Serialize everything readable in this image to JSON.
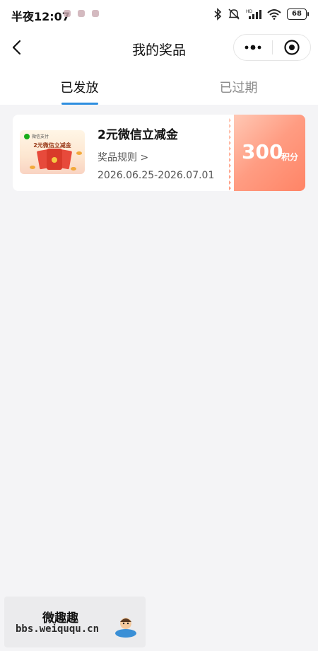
{
  "status_bar": {
    "time": "半夜12:07",
    "battery": "68"
  },
  "nav": {
    "title": "我的奖品"
  },
  "tabs": [
    {
      "label": "已发放",
      "active": true
    },
    {
      "label": "已过期",
      "active": false
    }
  ],
  "prizes": [
    {
      "title": "2元微信立减金",
      "rule_link": "奖品规则 >",
      "validity": "2026.06.25-2026.07.01",
      "points_value": "300",
      "points_unit": "积分",
      "thumbnail": {
        "brand": "微信支付",
        "caption": "2元微信立减金"
      }
    }
  ],
  "watermark": {
    "title": "微趣趣",
    "url": "bbs.weiququ.cn"
  },
  "colors": {
    "tab_indicator": "#2d8ee0",
    "points_gradient_start": "#ffcbb8",
    "points_gradient_end": "#ff8466",
    "page_background": "#f4f4f6"
  }
}
